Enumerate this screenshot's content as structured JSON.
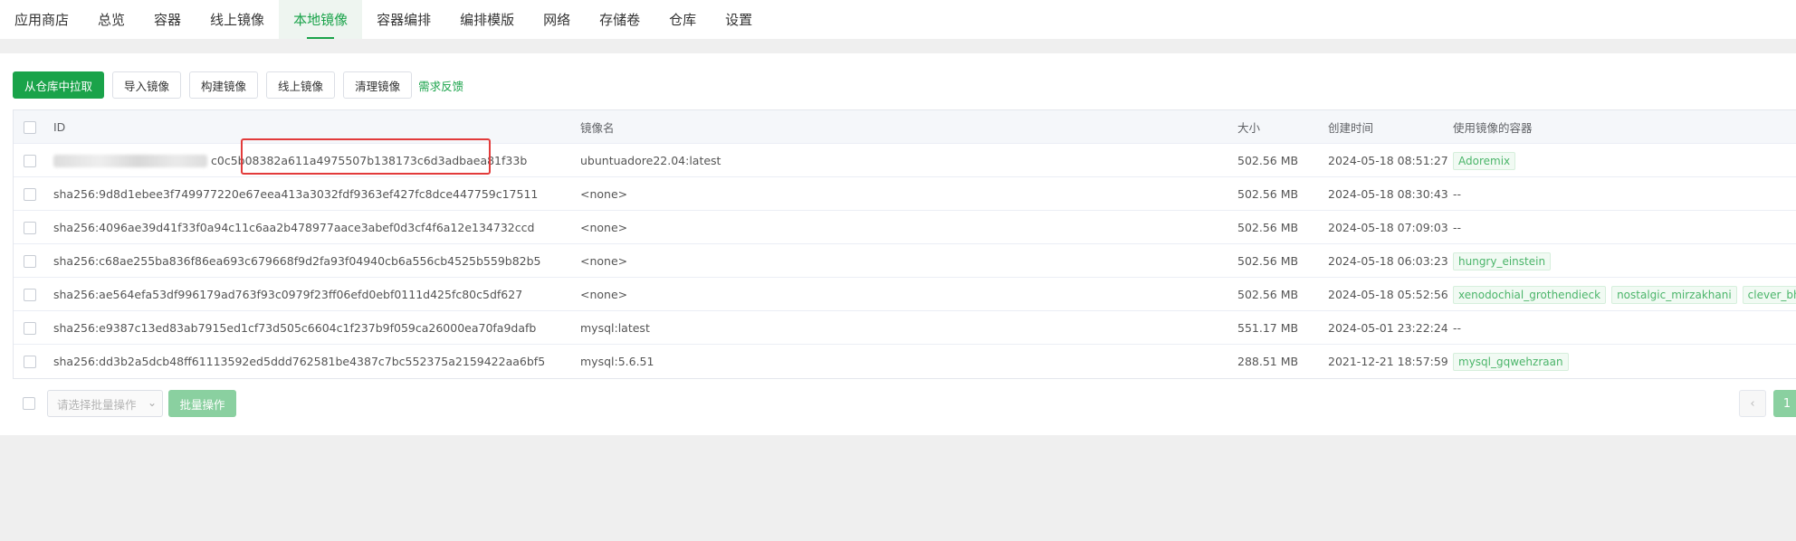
{
  "nav": {
    "tabs": [
      {
        "label": "应用商店"
      },
      {
        "label": "总览"
      },
      {
        "label": "容器"
      },
      {
        "label": "线上镜像"
      },
      {
        "label": "本地镜像",
        "active": true
      },
      {
        "label": "容器编排"
      },
      {
        "label": "编排模版"
      },
      {
        "label": "网络"
      },
      {
        "label": "存储卷"
      },
      {
        "label": "仓库"
      },
      {
        "label": "设置"
      }
    ]
  },
  "toolbar": {
    "pull_label": "从仓库中拉取",
    "import_label": "导入镜像",
    "build_label": "构建镜像",
    "online_label": "线上镜像",
    "clean_label": "清理镜像",
    "feedback_label": "需求反馈"
  },
  "table": {
    "headers": {
      "id": "ID",
      "name": "镜像名",
      "size": "大小",
      "created": "创建时间",
      "containers": "使用镜像的容器"
    },
    "rows": [
      {
        "id": "c0c5b08382a611a4975507b138173c6d3adbaea81f33b",
        "name": "ubuntuadore22.04:latest",
        "size": "502.56 MB",
        "created": "2024-05-18 08:51:27",
        "containers": [
          "Adoremix"
        ],
        "redacted": true
      },
      {
        "id": "sha256:9d8d1ebee3f749977220e67eea413a3032fdf9363ef427fc8dce447759c17511",
        "name": "<none>",
        "size": "502.56 MB",
        "created": "2024-05-18 08:30:43",
        "containers": [],
        "none_text": "--"
      },
      {
        "id": "sha256:4096ae39d41f33f0a94c11c6aa2b478977aace3abef0d3cf4f6a12e134732ccd",
        "name": "<none>",
        "size": "502.56 MB",
        "created": "2024-05-18 07:09:03",
        "containers": [],
        "none_text": "--"
      },
      {
        "id": "sha256:c68ae255ba836f86ea693c679668f9d2fa93f04940cb6a556cb4525b559b82b5",
        "name": "<none>",
        "size": "502.56 MB",
        "created": "2024-05-18 06:03:23",
        "containers": [
          "hungry_einstein"
        ]
      },
      {
        "id": "sha256:ae564efa53df996179ad763f93c0979f23ff06efd0ebf0111d425fc80c5df627",
        "name": "<none>",
        "size": "502.56 MB",
        "created": "2024-05-18 05:52:56",
        "containers": [
          "xenodochial_grothendieck",
          "nostalgic_mirzakhani",
          "clever_bhaskara"
        ]
      },
      {
        "id": "sha256:e9387c13ed83ab7915ed1cf73d505c6604c1f237b9f059ca26000ea70fa9dafb",
        "name": "mysql:latest",
        "size": "551.17 MB",
        "created": "2024-05-01 23:22:24",
        "containers": [],
        "none_text": "--"
      },
      {
        "id": "sha256:dd3b2a5dcb48ff61113592ed5ddd762581be4387c7bc552375a2159422aa6bf5",
        "name": "mysql:5.6.51",
        "size": "288.51 MB",
        "created": "2021-12-21 18:57:59",
        "containers": [
          "mysql_gqwehzraan"
        ]
      }
    ]
  },
  "footer": {
    "batch_placeholder": "请选择批量操作",
    "batch_label": "批量操作",
    "prev_icon": "chevron-left-icon",
    "current_page": "1"
  },
  "colors": {
    "accent": "#1aa34a",
    "highlight": "#e23b3b"
  }
}
